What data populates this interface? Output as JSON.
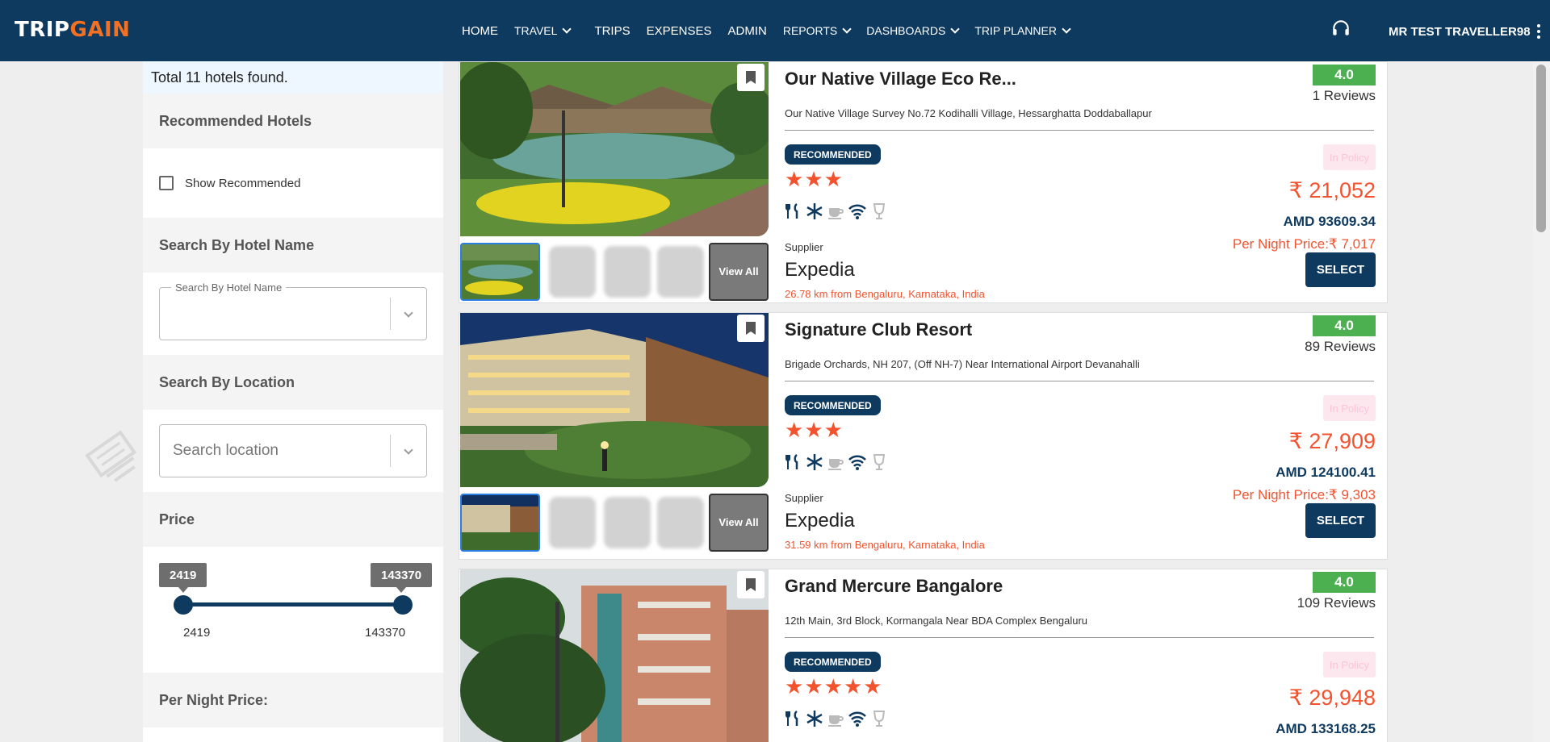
{
  "header": {
    "logo_left": "TRIP",
    "logo_right": "GAIN",
    "nav": [
      {
        "label": "HOME",
        "dropdown": false
      },
      {
        "label": "TRAVEL",
        "dropdown": true
      },
      {
        "label": "TRIPS",
        "dropdown": false
      },
      {
        "label": "EXPENSES",
        "dropdown": false
      },
      {
        "label": "ADMIN",
        "dropdown": false
      },
      {
        "label": "REPORTS",
        "dropdown": true
      },
      {
        "label": "DASHBOARDS",
        "dropdown": true
      },
      {
        "label": "TRIP PLANNER",
        "dropdown": true
      }
    ],
    "support_icon": "headset-icon",
    "user_name": "MR TEST TRAVELLER98"
  },
  "sidebar": {
    "total": "Total 11 hotels found.",
    "recommended_heading": "Recommended Hotels",
    "show_recommended_label": "Show Recommended",
    "show_recommended_checked": false,
    "name_heading": "Search By Hotel Name",
    "name_field_label": "Search By Hotel Name",
    "name_value": "",
    "location_heading": "Search By Location",
    "location_placeholder": "Search location",
    "price_heading": "Price",
    "price_min": "2419",
    "price_max": "143370",
    "per_night_heading": "Per Night Price:"
  },
  "cards": [
    {
      "name": "Our Native Village Eco Re...",
      "address": "Our Native Village Survey No.72 Kodihalli Village, Hessarghatta Doddaballapur",
      "rating": "4.0",
      "reviews": "1 Reviews",
      "badge": "RECOMMENDED",
      "stars": 3,
      "policy": "In Policy",
      "price": "₹ 21,052",
      "amd": "AMD 93609.34",
      "per_night": "Per Night Price:₹ 7,017",
      "select": "SELECT",
      "supplier_label": "Supplier",
      "supplier": "Expedia",
      "distance": "26.78 km from Bengaluru, Karnataka, India",
      "view_all": "View All"
    },
    {
      "name": "Signature Club Resort",
      "address": "Brigade Orchards, NH 207, (Off NH-7) Near International Airport Devanahalli",
      "rating": "4.0",
      "reviews": "89 Reviews",
      "badge": "RECOMMENDED",
      "stars": 3,
      "policy": "In Policy",
      "price": "₹ 27,909",
      "amd": "AMD 124100.41",
      "per_night": "Per Night Price:₹ 9,303",
      "select": "SELECT",
      "supplier_label": "Supplier",
      "supplier": "Expedia",
      "distance": "31.59 km from Bengaluru, Karnataka, India",
      "view_all": "View All"
    },
    {
      "name": "Grand Mercure Bangalore",
      "address": "12th Main, 3rd Block, Kormangala Near BDA Complex Bengaluru",
      "rating": "4.0",
      "reviews": "109 Reviews",
      "badge": "RECOMMENDED",
      "stars": 5,
      "policy": "In Policy",
      "price": "₹ 29,948",
      "amd": "AMD 133168.25"
    }
  ],
  "amenity_icons": [
    "restaurant-icon",
    "air-conditioning-icon",
    "coffee-icon",
    "wifi-icon",
    "bar-icon"
  ],
  "colors": {
    "brand_navy": "#0f3a5f",
    "brand_orange": "#f36f21",
    "price_orange": "#f3522e",
    "rating_green": "#4caf50"
  }
}
